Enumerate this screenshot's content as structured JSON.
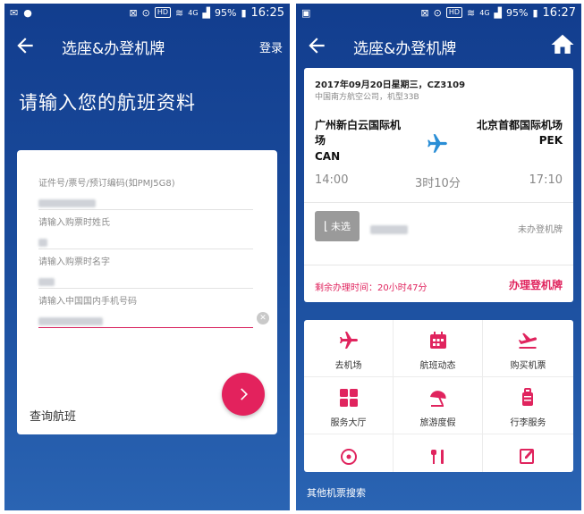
{
  "left_screen": {
    "status": {
      "time": "16:25",
      "battery": "95%",
      "hd": "HD",
      "network": "4G"
    },
    "title": "选座&办登机牌",
    "login_label": "登录",
    "heading": "请输入您的航班资料",
    "fields": [
      {
        "label": "证件号/票号/预订编码(如PMJ5G8)"
      },
      {
        "label": "请输入购票时姓氏"
      },
      {
        "label": "请输入购票时名字"
      },
      {
        "label": "请输入中国国内手机号码"
      }
    ],
    "query_label": "查询航班"
  },
  "right_screen": {
    "status": {
      "time": "16:27",
      "battery": "95%",
      "hd": "HD",
      "network": "4G"
    },
    "title": "选座&办登机牌",
    "flight": {
      "date_flight": "2017年09月20日星期三，CZ3109",
      "airline_info": "中国南方航空公司，机型33B",
      "dep_airport_line1": "广州新白云国际机",
      "dep_airport_line2": "场",
      "dep_code": "CAN",
      "arr_airport": "北京首都国际机场",
      "arr_code": "PEK",
      "dep_time": "14:00",
      "duration": "3时10分",
      "arr_time": "17:10",
      "seat_status": "未选",
      "boarding_status": "未办登机牌",
      "remaining": "剩余办理时间：20小时47分",
      "checkin_label": "办理登机牌"
    },
    "services": [
      {
        "label": "去机场",
        "icon": "plane-icon"
      },
      {
        "label": "航班动态",
        "icon": "calendar-icon"
      },
      {
        "label": "购买机票",
        "icon": "plane-takeoff-icon"
      },
      {
        "label": "服务大厅",
        "icon": "grid-icon"
      },
      {
        "label": "旅游度假",
        "icon": "umbrella-icon"
      },
      {
        "label": "行李服务",
        "icon": "luggage-icon"
      }
    ],
    "other_search": "其他机票搜索"
  },
  "colors": {
    "accent": "#e0245e",
    "blue": "#1c4f9f"
  }
}
